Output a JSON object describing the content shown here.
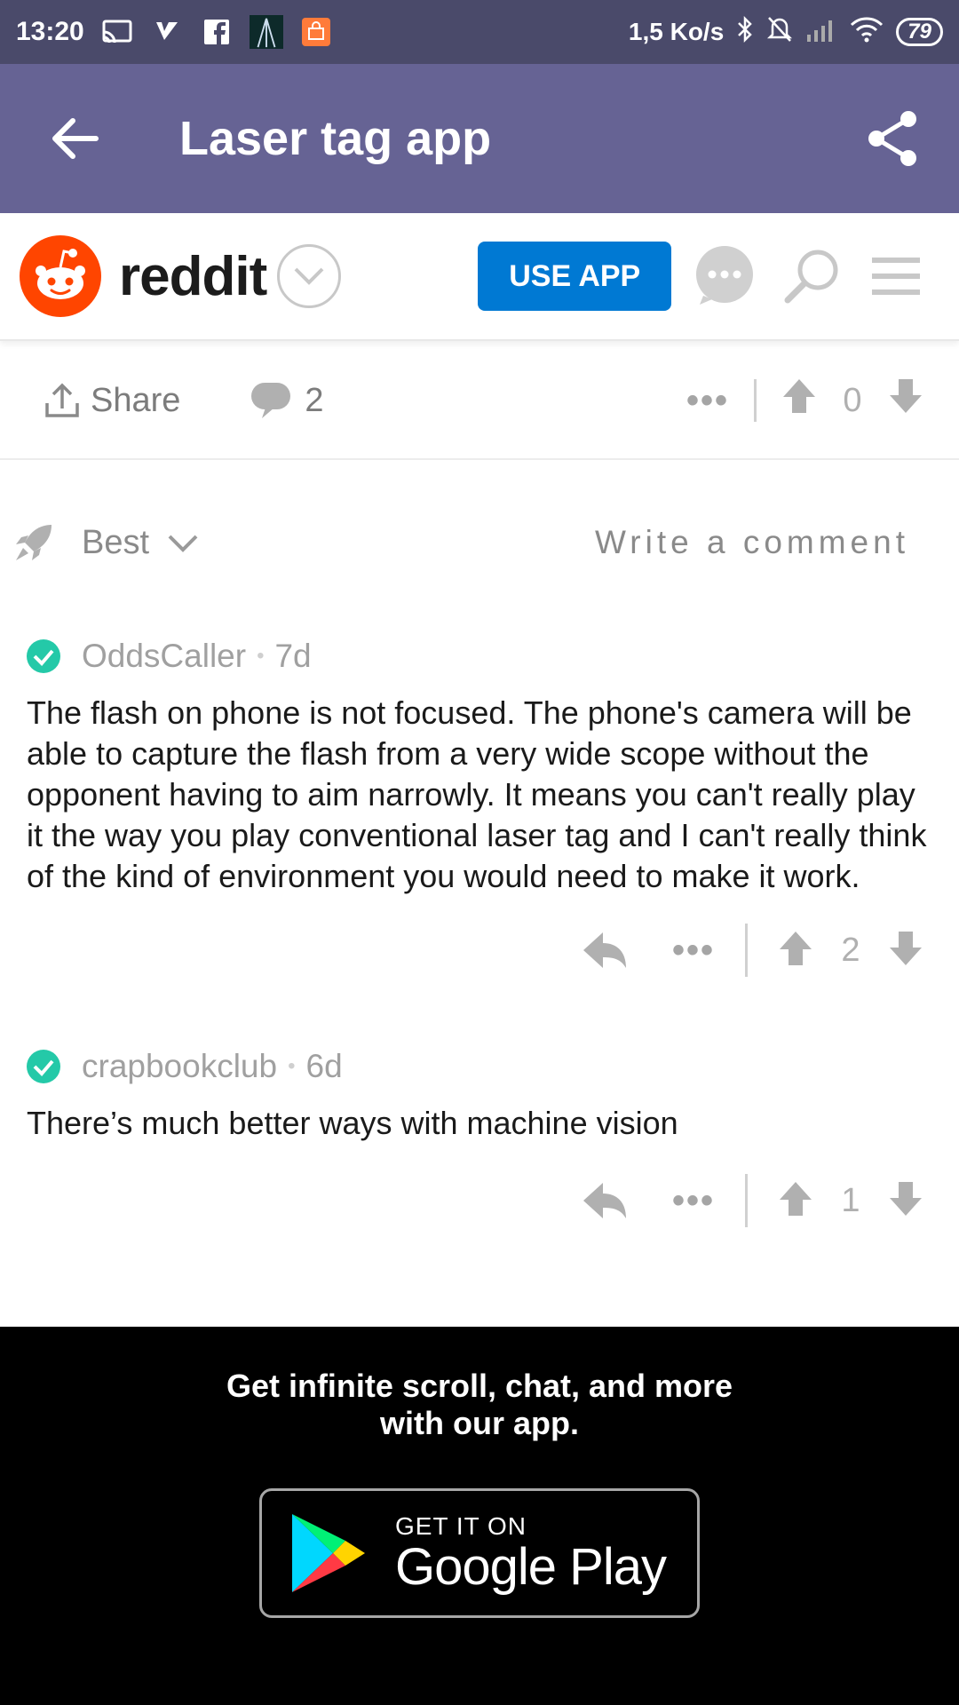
{
  "status_bar": {
    "time": "13:20",
    "speed": "1,5 Ko/s",
    "battery": "79"
  },
  "app_bar": {
    "title": "Laser tag app"
  },
  "reddit_header": {
    "wordmark": "reddit",
    "use_app_label": "USE APP"
  },
  "post_actions": {
    "share_label": "Share",
    "comment_count": "2",
    "vote_count": "0"
  },
  "sort": {
    "label": "Best",
    "write_comment": "Write a comment"
  },
  "comments": [
    {
      "author": "OddsCaller",
      "age": "7d",
      "body": "The flash on phone is not focused. The phone's camera will be able to capture the flash from a very wide scope without the opponent having to aim narrowly. It means you can't really play it the way you play conventional laser tag and I can't really think of the kind of environment you would need to make it work.",
      "votes": "2"
    },
    {
      "author": "crapbookclub",
      "age": "6d",
      "body": "There’s much better ways with machine vision",
      "votes": "1"
    }
  ],
  "banner": {
    "line1": "Get infinite scroll, chat, and more",
    "line2": "with our app.",
    "gplay_small": "GET IT ON",
    "gplay_big": "Google Play"
  },
  "colors": {
    "status_bar": "#4a4a6a",
    "app_bar": "#666394",
    "reddit_orange": "#ff4500",
    "use_app_blue": "#0079d3",
    "verified_teal": "#24c9a8"
  },
  "icons": [
    "cast-icon",
    "check-flag-icon",
    "facebook-icon",
    "app-thumb-icon",
    "shopping-icon",
    "bluetooth-icon",
    "bell-off-icon",
    "signal-icon",
    "wifi-icon",
    "back-arrow-icon",
    "share-icon",
    "snoo-logo-icon",
    "chevron-down-icon",
    "chat-bubble-icon",
    "search-icon",
    "hamburger-menu-icon",
    "upload-share-icon",
    "comment-icon",
    "more-dots-icon",
    "upvote-icon",
    "downvote-icon",
    "rocket-icon",
    "verified-check-icon",
    "reply-icon",
    "google-play-logo-icon"
  ]
}
